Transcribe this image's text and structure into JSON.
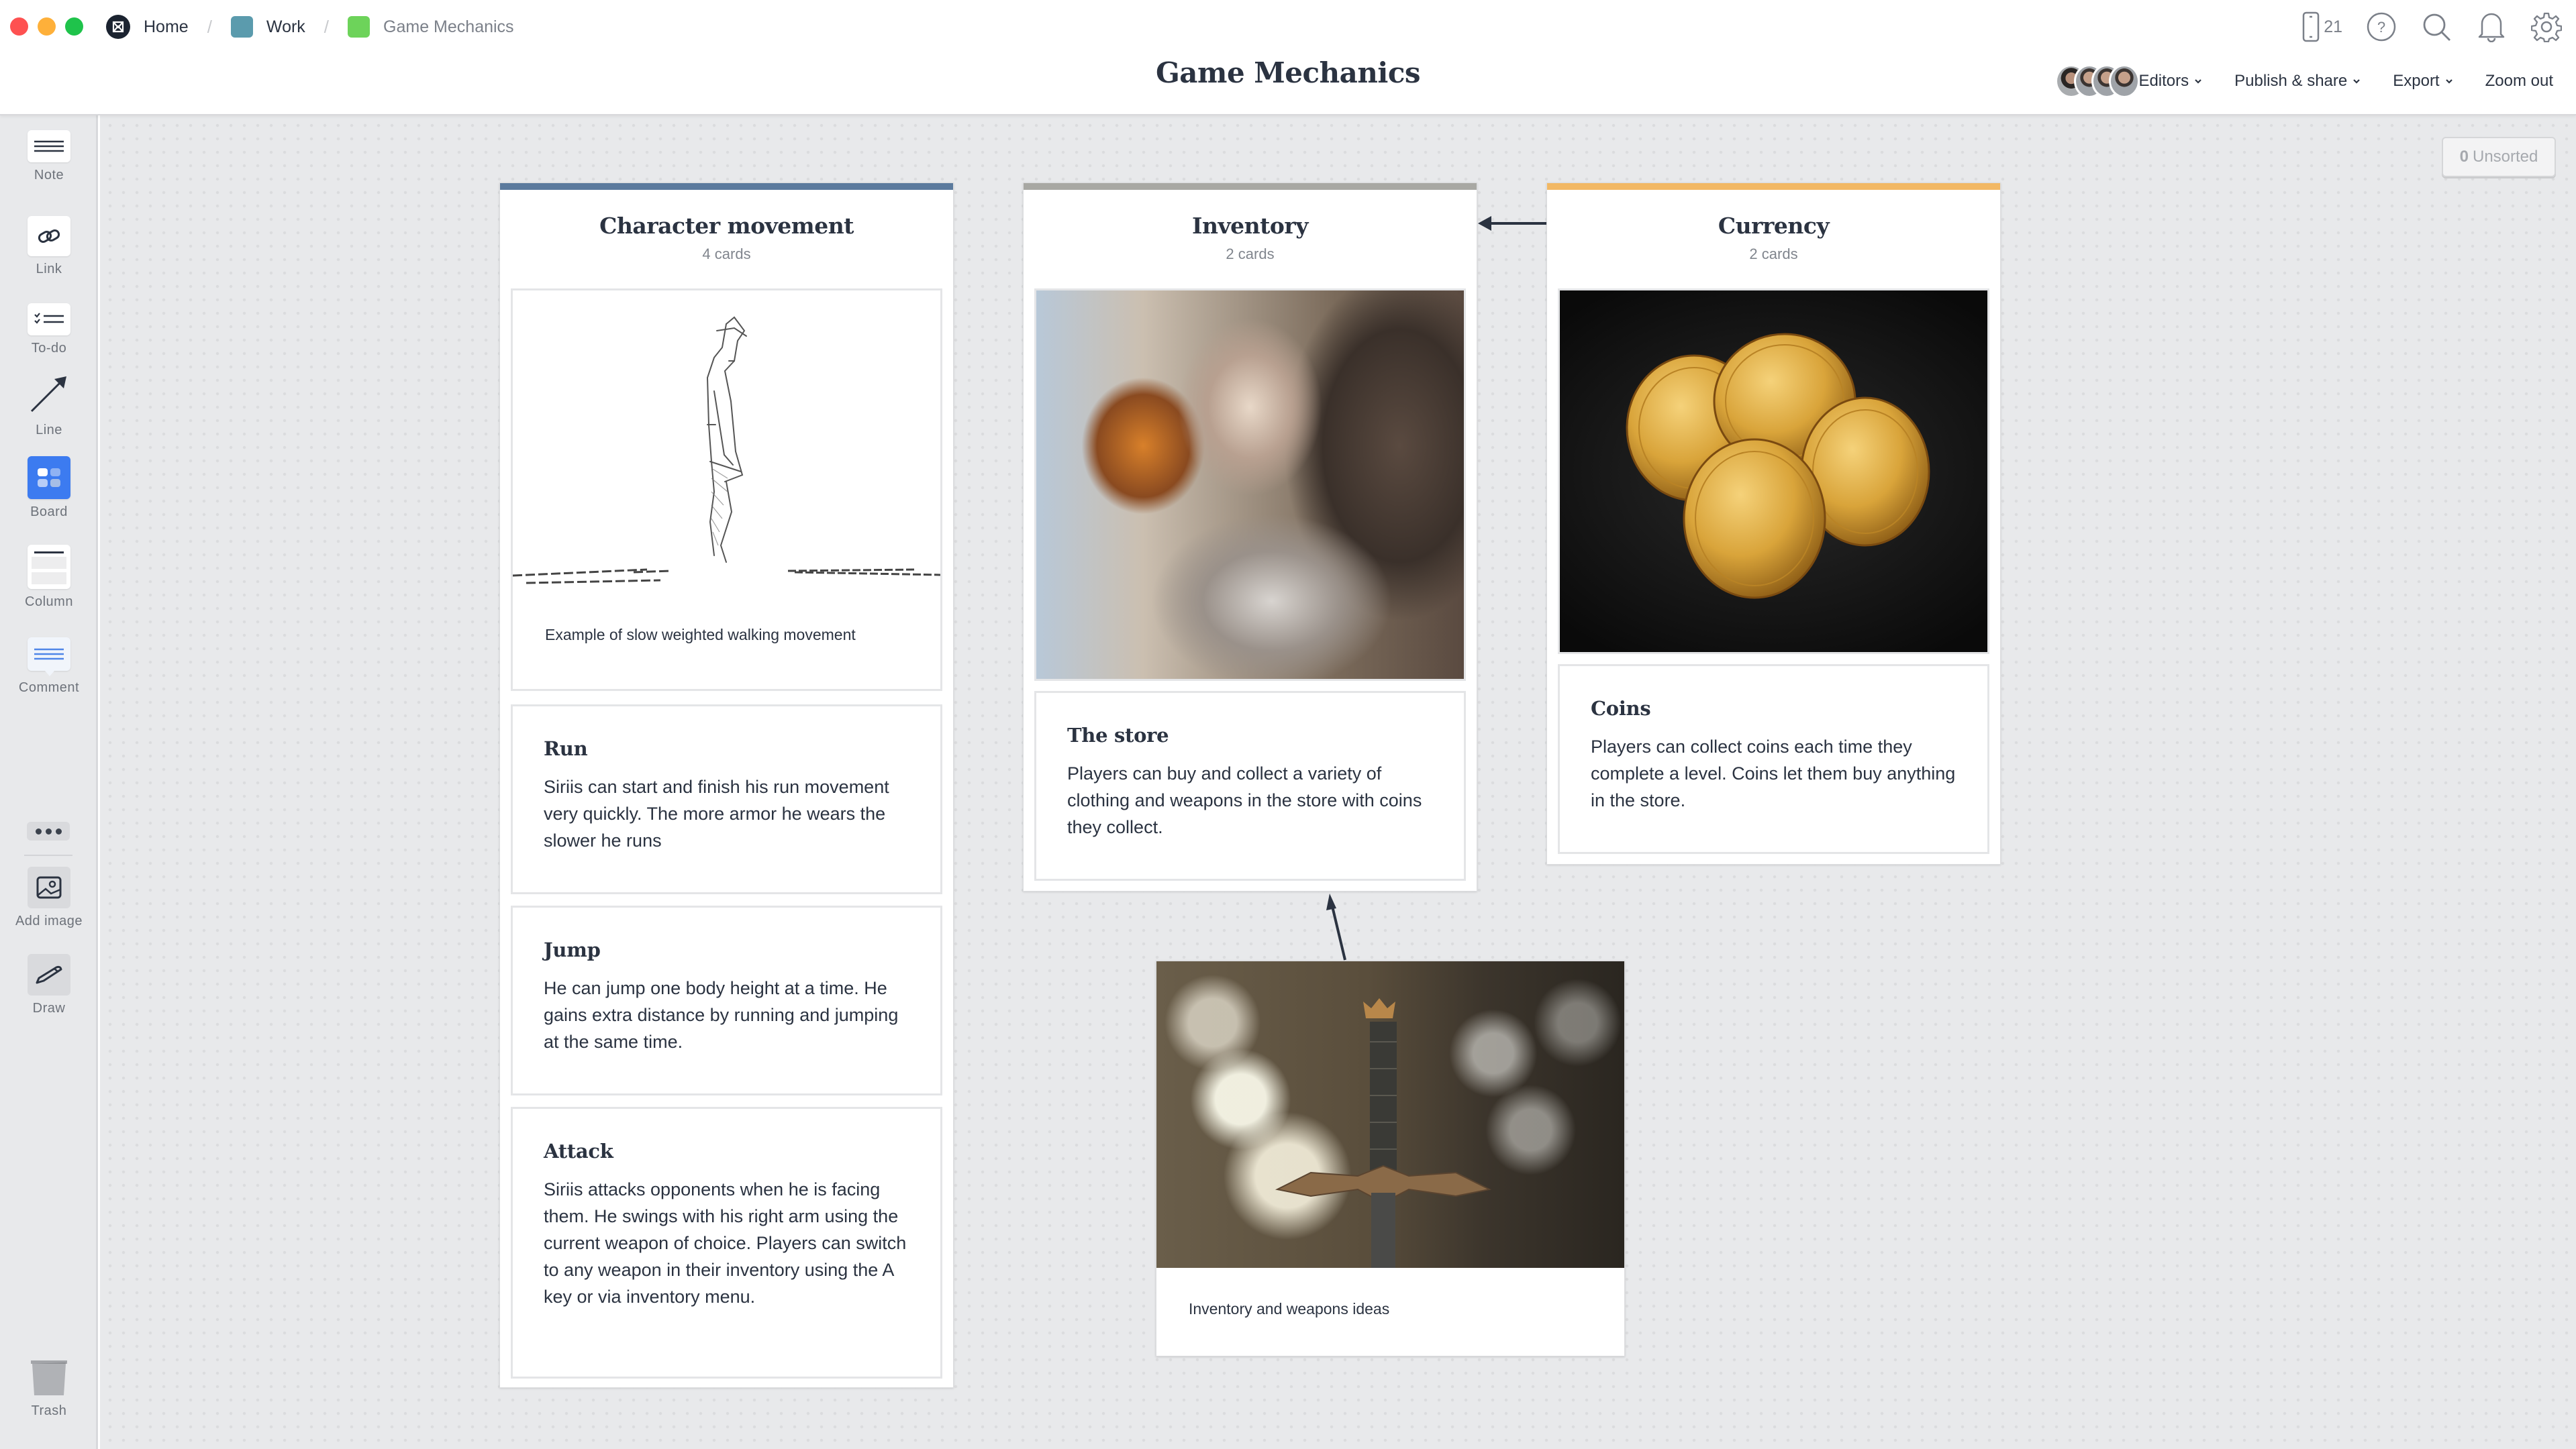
{
  "window": {
    "traffic_lights": [
      "close",
      "minimize",
      "maximize"
    ]
  },
  "breadcrumb": [
    {
      "label": "Home",
      "icon": "milanote-logo-icon"
    },
    {
      "label": "Work",
      "color": "#5b9bad"
    },
    {
      "label": "Game Mechanics",
      "color": "#6dd35a"
    }
  ],
  "header": {
    "title": "Game Mechanics",
    "device_count": "21",
    "icons": [
      "mobile-icon",
      "help-icon",
      "search-icon",
      "bell-icon",
      "gear-icon"
    ],
    "editors_label": "Editors",
    "publish_label": "Publish & share",
    "export_label": "Export",
    "zoom_label": "Zoom out",
    "editor_avatar_count": 4
  },
  "toolbar": {
    "items": [
      {
        "label": "Note",
        "icon": "note-icon"
      },
      {
        "label": "Link",
        "icon": "link-icon"
      },
      {
        "label": "To-do",
        "icon": "todo-icon"
      },
      {
        "label": "Line",
        "icon": "line-arrow-icon"
      },
      {
        "label": "Board",
        "icon": "board-icon"
      },
      {
        "label": "Column",
        "icon": "column-icon"
      },
      {
        "label": "Comment",
        "icon": "comment-icon"
      },
      {
        "label": "Add image",
        "icon": "image-icon"
      },
      {
        "label": "Draw",
        "icon": "pencil-icon"
      },
      {
        "label": "Trash",
        "icon": "trash-icon"
      }
    ],
    "more_icon": "more-dots-icon"
  },
  "unsorted": {
    "count": "0",
    "label": "Unsorted"
  },
  "columns": [
    {
      "title": "Character movement",
      "count_label": "4 cards",
      "accent": "#5b7a9d",
      "cards": [
        {
          "type": "image",
          "image": "walking-sketch",
          "caption": "Example of slow weighted walking movement"
        },
        {
          "type": "note",
          "title": "Run",
          "body": "Siriis can start and finish his run movement very quickly. The more armor he wears the slower he runs"
        },
        {
          "type": "note",
          "title": "Jump",
          "body": "He can jump one body height at a time. He gains extra distance by running and jumping at the same time."
        },
        {
          "type": "note",
          "title": "Attack",
          "body": "Siriis attacks opponents when he is facing them. He swings with his right arm using the current weapon of choice. Players can switch to any weapon in their inventory using the A key or via inventory menu."
        }
      ]
    },
    {
      "title": "Inventory",
      "count_label": "2 cards",
      "accent": "#a8a8a3",
      "cards": [
        {
          "type": "image",
          "image": "knight-armor-photo"
        },
        {
          "type": "note",
          "title": "The store",
          "body": "Players can buy and collect a variety of clothing and weapons in the store with coins they collect."
        }
      ]
    },
    {
      "title": "Currency",
      "count_label": "2 cards",
      "accent": "#f2b864",
      "cards": [
        {
          "type": "image",
          "image": "gold-coins-photo"
        },
        {
          "type": "note",
          "title": "Coins",
          "body": "Players can collect coins each time they complete a level. Coins let them buy anything in the store."
        }
      ]
    }
  ],
  "floating_card": {
    "image": "sword-photo",
    "caption": "Inventory and weapons ideas"
  },
  "connectors": [
    {
      "from": "Currency",
      "to": "Inventory"
    },
    {
      "from": "Inventory and weapons ideas",
      "to": "Inventory"
    }
  ]
}
